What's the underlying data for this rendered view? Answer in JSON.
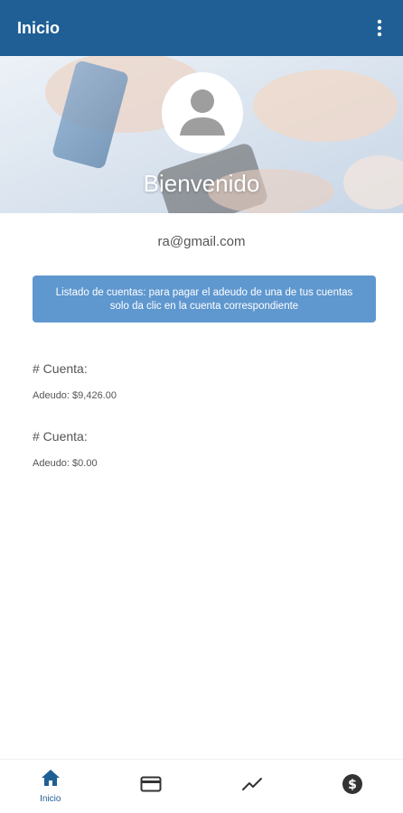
{
  "appbar": {
    "title": "Inicio",
    "menu_icon": "more-vert-icon"
  },
  "hero": {
    "welcome": "Bienvenido",
    "avatar_icon": "user-avatar-icon"
  },
  "user": {
    "email": "ra@gmail.com"
  },
  "info": {
    "line1": "Listado de cuentas: para pagar el adeudo de una de tus cuentas",
    "line2": "solo da clic en la cuenta correspondiente"
  },
  "accounts": [
    {
      "label": "# Cuenta:",
      "debt": "Adeudo: $9,426.00"
    },
    {
      "label": "# Cuenta:",
      "debt": "Adeudo: $0.00"
    }
  ],
  "nav": {
    "items": [
      {
        "icon": "home-icon",
        "label": "Inicio",
        "active": true
      },
      {
        "icon": "credit-card-icon",
        "label": ""
      },
      {
        "icon": "trending-icon",
        "label": ""
      },
      {
        "icon": "dollar-circle-icon",
        "label": ""
      }
    ]
  },
  "colors": {
    "primary": "#1f5f95",
    "info_box": "#5f97cf"
  }
}
